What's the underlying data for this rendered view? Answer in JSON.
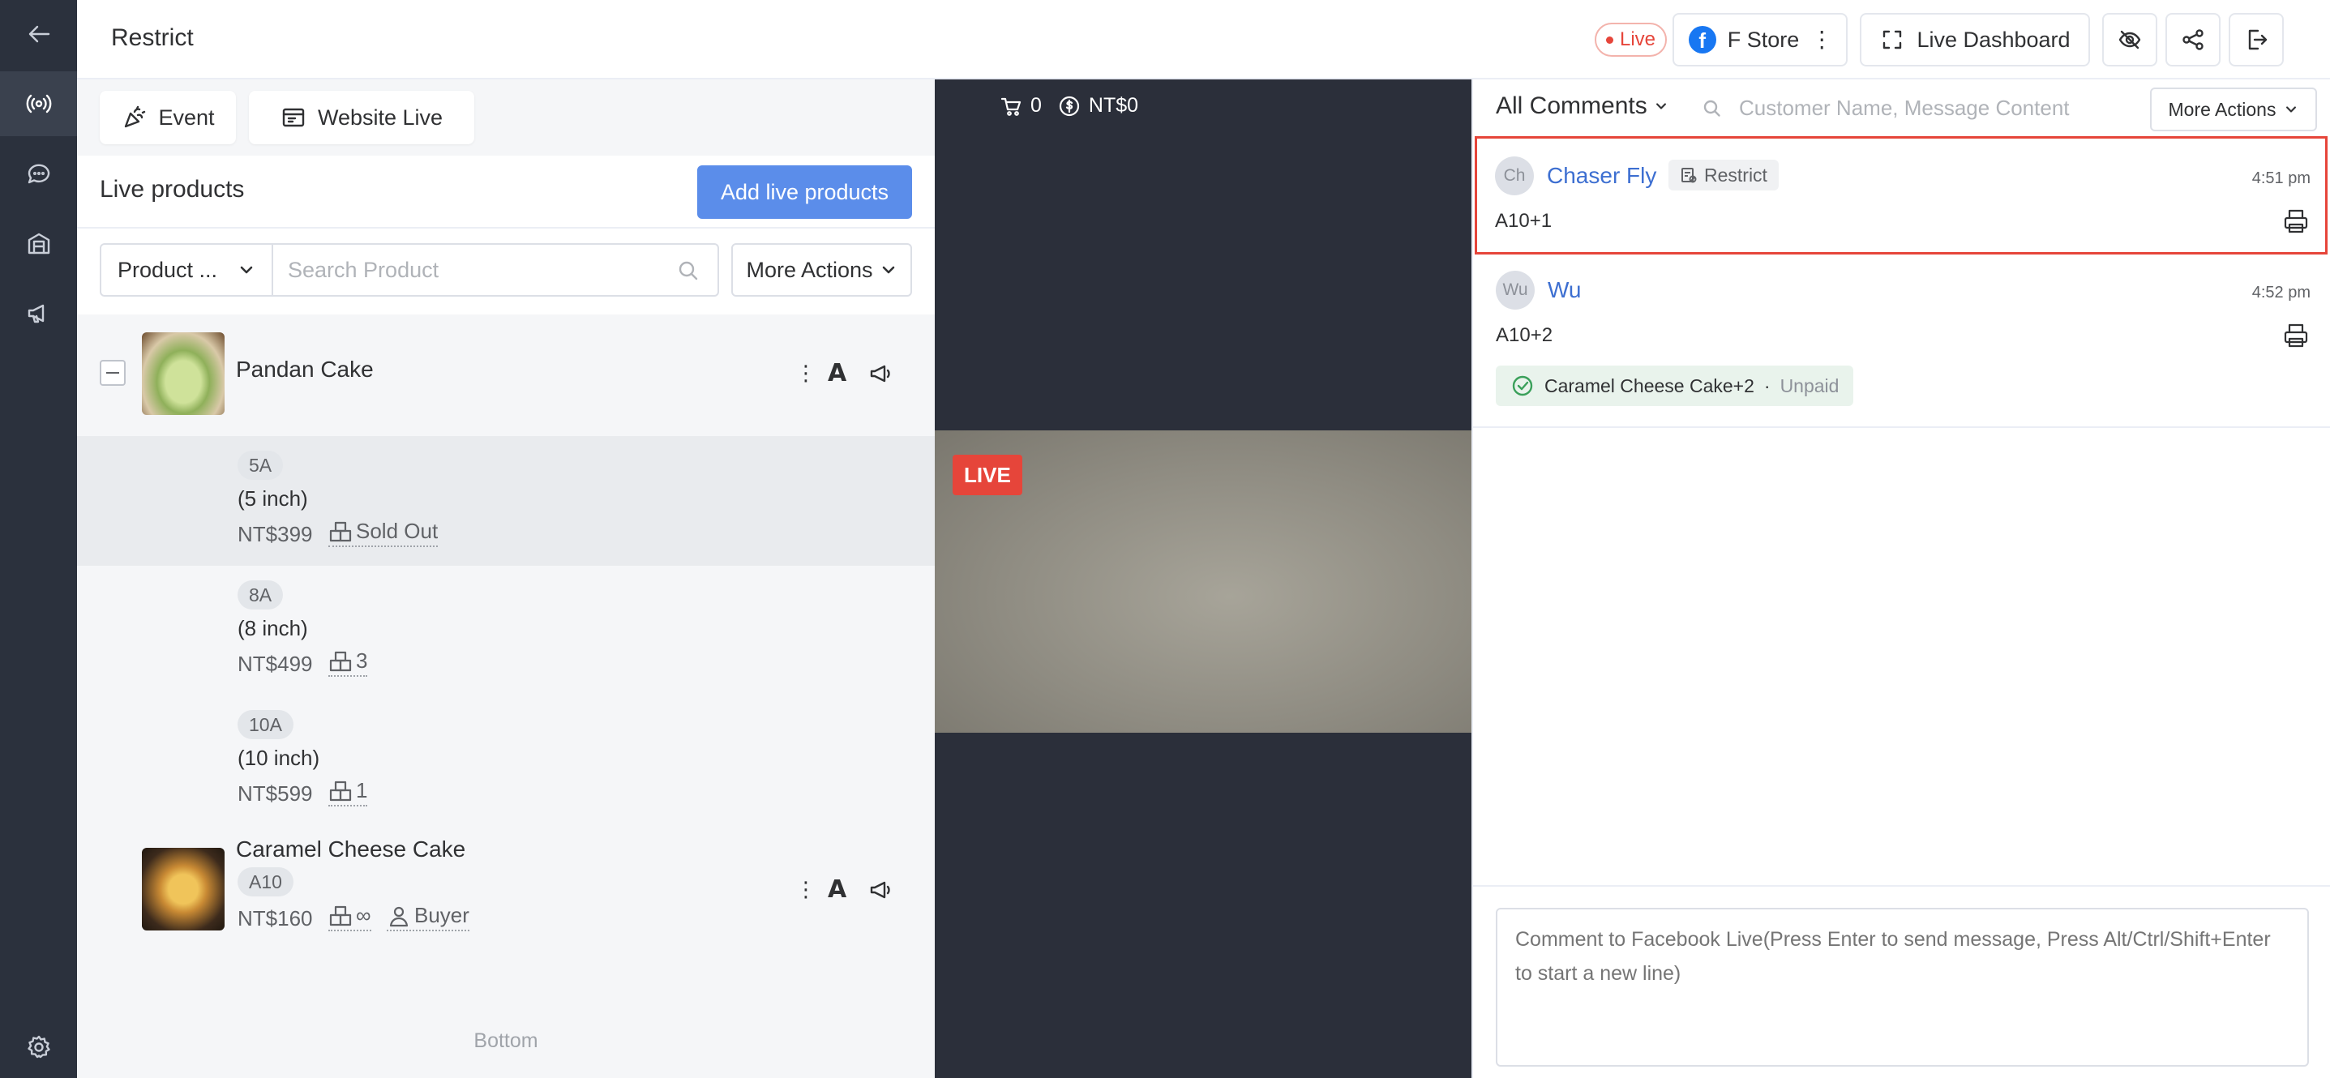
{
  "header": {
    "title": "Restrict",
    "live_badge": "Live",
    "store_name": "F Store",
    "dashboard_label": "Live Dashboard"
  },
  "left_panel": {
    "tabs": [
      {
        "label": "Event",
        "icon": "party-popper-icon"
      },
      {
        "label": "Website Live",
        "icon": "browser-icon"
      }
    ],
    "products_heading": "Live products",
    "add_button": "Add live products",
    "filter_select": "Product ...",
    "search_placeholder": "Search Product",
    "more_actions": "More Actions",
    "bottom_label": "Bottom",
    "products": [
      {
        "name": "Pandan Cake",
        "variants": [
          {
            "tag": "5A",
            "size": "(5 inch)",
            "price": "NT$399",
            "stock": "Sold Out"
          },
          {
            "tag": "8A",
            "size": "(8 inch)",
            "price": "NT$499",
            "stock": "3"
          },
          {
            "tag": "10A",
            "size": "(10 inch)",
            "price": "NT$599",
            "stock": "1"
          }
        ]
      },
      {
        "name": "Caramel Cheese Cake",
        "tag": "A10",
        "price": "NT$160",
        "stock": "∞",
        "buyer": "Buyer"
      }
    ]
  },
  "video": {
    "cart_count": "0",
    "revenue": "NT$0",
    "live_label": "LIVE"
  },
  "comments": {
    "filter_label": "All Comments",
    "search_placeholder": "Customer Name, Message Content",
    "more_actions": "More Actions",
    "items": [
      {
        "initials": "Ch",
        "name": "Chaser Fly",
        "tag": "Restrict",
        "time": "4:51 pm",
        "message": "A10+1"
      },
      {
        "initials": "Wu",
        "name": "Wu",
        "time": "4:52 pm",
        "message": "A10+2",
        "order": "Caramel Cheese Cake+2",
        "order_sep": "·",
        "order_status": "Unpaid"
      }
    ],
    "compose_placeholder": "Comment to Facebook Live(Press Enter to send message, Press Alt/Ctrl/Shift+Enter to start a new line)"
  },
  "colors": {
    "accent": "#5b8dea",
    "live_red": "#e6453a",
    "rail_bg": "#2b313d",
    "video_bg": "#2b2f3a",
    "name_blue": "#3d6fd1",
    "paid_green": "#3aa05a"
  }
}
